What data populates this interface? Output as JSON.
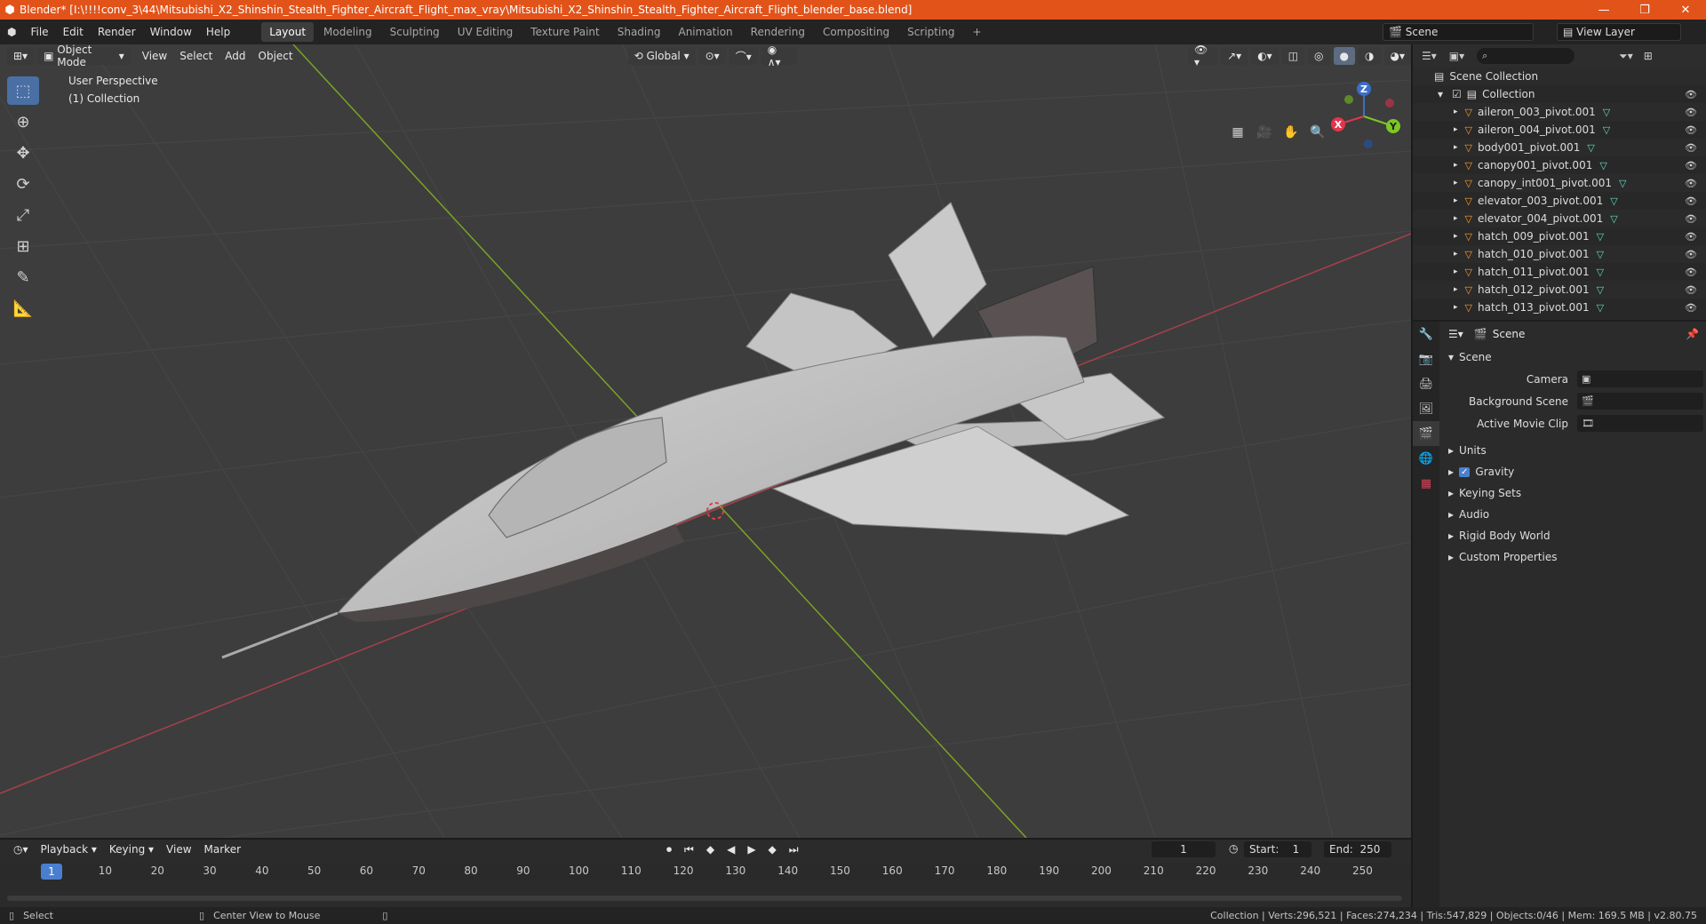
{
  "titlebar": {
    "title": "Blender* [I:\\!!!!conv_3\\44\\Mitsubishi_X2_Shinshin_Stealth_Fighter_Aircraft_Flight_max_vray\\Mitsubishi_X2_Shinshin_Stealth_Fighter_Aircraft_Flight_blender_base.blend]",
    "logo_icon": "blender-logo-icon",
    "bg_color": "#e2531a"
  },
  "menu": [
    "File",
    "Edit",
    "Render",
    "Window",
    "Help"
  ],
  "workspaces": [
    "Layout",
    "Modeling",
    "Sculpting",
    "UV Editing",
    "Texture Paint",
    "Shading",
    "Animation",
    "Rendering",
    "Compositing",
    "Scripting"
  ],
  "active_workspace": "Layout",
  "scene_selector": "Scene",
  "view_layer_selector": "View Layer",
  "viewport": {
    "mode": "Object Mode",
    "menus": [
      "View",
      "Select",
      "Add",
      "Object"
    ],
    "transform_orientation": "Global",
    "overlay_title": "User Perspective",
    "overlay_collection": "(1) Collection",
    "gizmo": {
      "x": "X",
      "y": "Y",
      "z": "Z"
    }
  },
  "outliner": {
    "root": "Scene Collection",
    "collection": "Collection",
    "items": [
      "aileron_003_pivot.001",
      "aileron_004_pivot.001",
      "body001_pivot.001",
      "canopy001_pivot.001",
      "canopy_int001_pivot.001",
      "elevator_003_pivot.001",
      "elevator_004_pivot.001",
      "hatch_009_pivot.001",
      "hatch_010_pivot.001",
      "hatch_011_pivot.001",
      "hatch_012_pivot.001",
      "hatch_013_pivot.001"
    ]
  },
  "properties": {
    "header": "Scene",
    "section": "Scene",
    "fields": [
      {
        "label": "Camera",
        "value": ""
      },
      {
        "label": "Background Scene",
        "value": ""
      },
      {
        "label": "Active Movie Clip",
        "value": ""
      }
    ],
    "subsections": [
      "Units",
      "Gravity",
      "Keying Sets",
      "Audio",
      "Rigid Body World",
      "Custom Properties"
    ],
    "gravity_checked": true
  },
  "timeline": {
    "menus": [
      "Playback",
      "Keying",
      "View",
      "Marker"
    ],
    "current_frame": "1",
    "start_label": "Start:",
    "start": "1",
    "end_label": "End:",
    "end": "250",
    "ticks": [
      "1",
      "10",
      "20",
      "30",
      "40",
      "50",
      "60",
      "70",
      "80",
      "90",
      "100",
      "110",
      "120",
      "130",
      "140",
      "150",
      "160",
      "170",
      "180",
      "190",
      "200",
      "210",
      "220",
      "230",
      "240",
      "250"
    ]
  },
  "statusbar": {
    "left": "Select",
    "middle": "Center View to Mouse",
    "right": "Collection | Verts:296,521 | Faces:274,234 | Tris:547,829 | Objects:0/46 | Mem: 169.5 MB | v2.80.75"
  }
}
